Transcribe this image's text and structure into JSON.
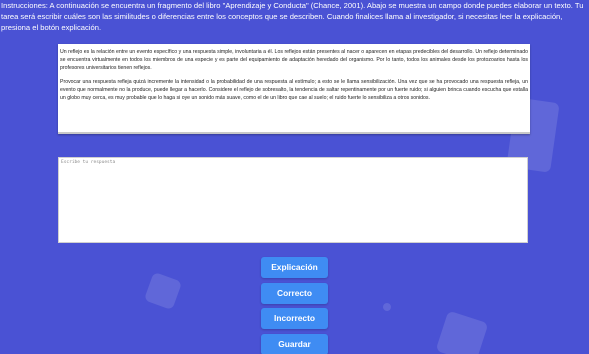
{
  "instructions": "Instrucciones: A continuación se encuentra un fragmento del libro \"Aprendizaje y Conducta\" (Chance, 2001). Abajo se muestra un campo donde puedes elaborar un texto. Tu tarea será escribir cuáles son las similitudes o diferencias entre los conceptos que se describen. Cuando finalices llama al investigador, si necesitas leer la explicación, presiona el botón explicación.",
  "reading": {
    "paragraphs": [
      "Un reflejo es la relación entre un evento específico y una respuesta simple, involuntaria a él. Los reflejos están presentes al nacer o aparecen en etapas predecibles del desarrollo. Un reflejo determinado se encuentra virtualmente en todos los miembros de una especie y es parte del equipamiento de adaptación heredado del organismo. Por lo tanto, todos los animales desde los protozoarios hasta los profesores universitarios tienen reflejos.",
      "Provocar una respuesta refleja quizá incremente la intensidad o la probabilidad de una respuesta al estímulo; a esto se le llama sensibilización. Una vez que se ha provocado una respuesta refleja, un evento que normalmente no la produce, puede llegar a hacerlo. Considere el reflejo de sobresalto, la tendencia de saltar repentinamente por un fuerte ruido; si alguien brinca cuando escucha que estalla un globo muy cerca, es muy probable que lo haga si oye un sonido más suave, como el de un libro que cae al suelo; el ruido fuerte lo sensibiliza a otros sonidos."
    ]
  },
  "answer": {
    "placeholder": "Escribe tu respuesta",
    "value": ""
  },
  "buttons": {
    "explanation": "Explicación",
    "correct": "Correcto",
    "incorrect": "Incorrecto",
    "save": "Guardar"
  },
  "colors": {
    "background": "#4a52d4",
    "button": "#3f8cf3"
  }
}
